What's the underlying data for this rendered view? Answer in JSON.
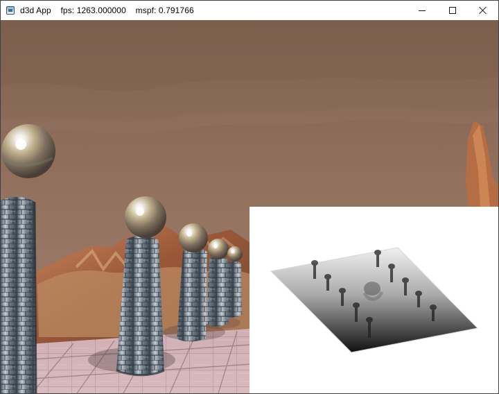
{
  "window": {
    "app_name": "d3d App",
    "fps_label": "fps:",
    "fps_value": "1263.000000",
    "mspf_label": "mspf:",
    "mspf_value": "0.791766"
  },
  "controls": {
    "minimize": "minimize-icon",
    "maximize": "maximize-icon",
    "close": "close-icon"
  },
  "scene": {
    "type": "3d-render",
    "sky_color": "#8f6e58",
    "ground_color": "#b78572",
    "mountain_color": "#a8603c",
    "pillar_color": "#747f8b",
    "sphere_color": "#c9b690"
  },
  "shadow_map": {
    "background": "#ffffff",
    "plane_light": "#eeeeee",
    "plane_dark": "#111111"
  }
}
